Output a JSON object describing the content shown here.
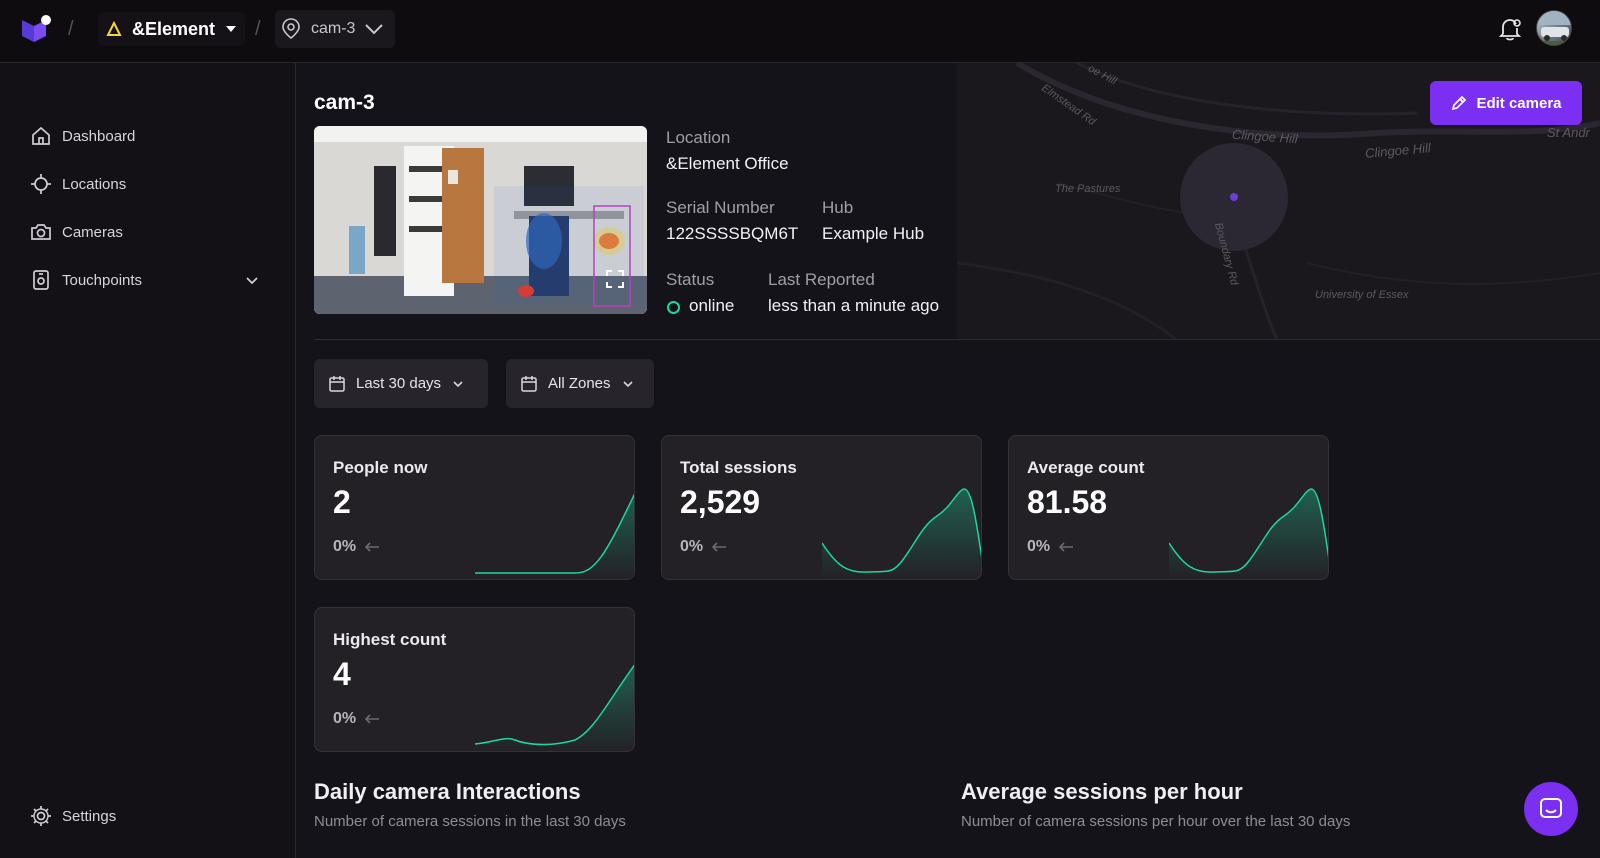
{
  "topbar": {
    "org_label": "&Element",
    "camera_label": "cam-3"
  },
  "sidebar": {
    "items": [
      {
        "label": "Dashboard",
        "icon": "home-icon"
      },
      {
        "label": "Locations",
        "icon": "crosshair-icon"
      },
      {
        "label": "Cameras",
        "icon": "camera-icon"
      },
      {
        "label": "Touchpoints",
        "icon": "touchpoint-icon"
      }
    ],
    "settings_label": "Settings"
  },
  "camera": {
    "title": "cam-3",
    "edit_label": "Edit camera",
    "location_label": "Location",
    "location_value": "&Element Office",
    "serial_label": "Serial Number",
    "serial_value": "122SSSSBQM6T",
    "hub_label": "Hub",
    "hub_value": "Example Hub",
    "status_label": "Status",
    "status_value": "online",
    "last_reported_label": "Last Reported",
    "last_reported_value": "less than a minute ago",
    "status_color": "#1dd7a0"
  },
  "map": {
    "labels": [
      "Clingoe Hill",
      "Clingoe Hill",
      "The Pastures",
      "Boundary Rd",
      "University of Essex",
      "Elmstead Rd",
      "oe Hill",
      "St Andr"
    ]
  },
  "filters": {
    "date_range": "Last 30 days",
    "zones": "All Zones"
  },
  "stats": [
    {
      "title": "People now",
      "value": "2",
      "change": "0%"
    },
    {
      "title": "Total sessions",
      "value": "2,529",
      "change": "0%"
    },
    {
      "title": "Average count",
      "value": "81.58",
      "change": "0%"
    },
    {
      "title": "Highest count",
      "value": "4",
      "change": "0%"
    }
  ],
  "sections": {
    "daily_title": "Daily camera Interactions",
    "daily_sub": "Number of camera sessions in the last 30 days",
    "hourly_title": "Average sessions per hour",
    "hourly_sub": "Number of camera sessions per hour over the last 30 days"
  },
  "colors": {
    "accent": "#7b2ff0",
    "spark": "#1dd7a0"
  }
}
